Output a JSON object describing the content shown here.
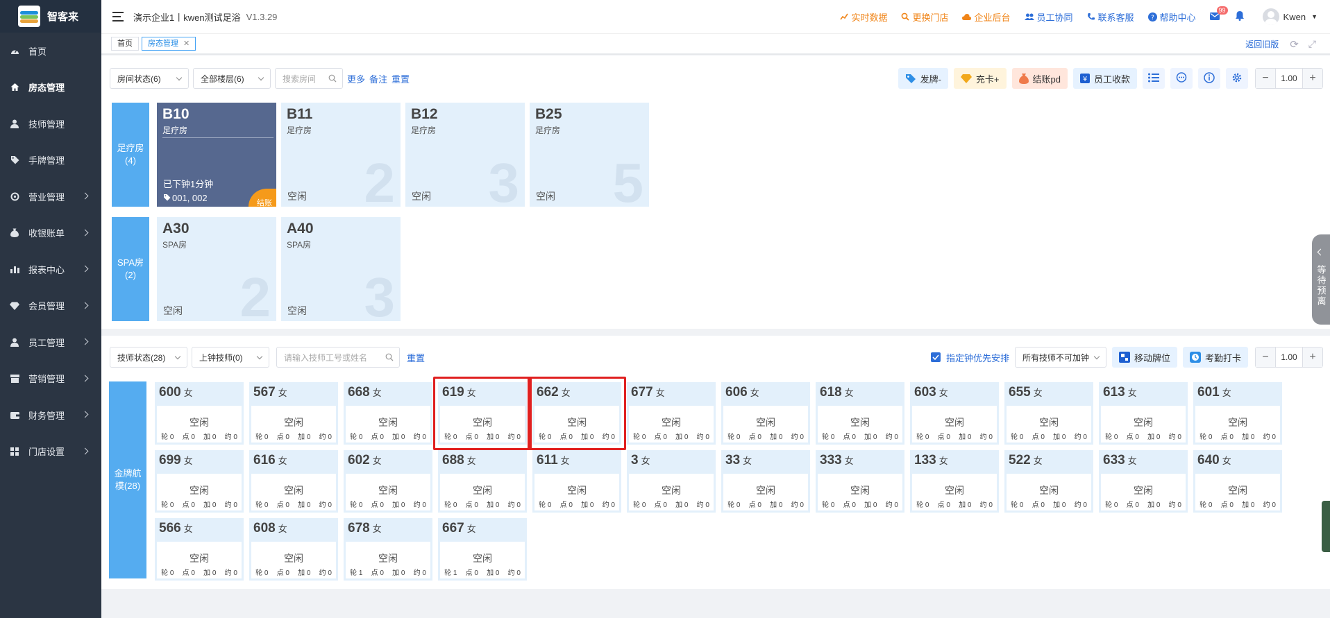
{
  "app": {
    "name": "智客来",
    "title": "演示企业1丨kwen测试足浴",
    "version": "V1.3.29"
  },
  "sidebar": {
    "items": [
      {
        "label": "首页",
        "icon": "dashboard-icon"
      },
      {
        "label": "房态管理",
        "icon": "home-icon",
        "active": true
      },
      {
        "label": "技师管理",
        "icon": "user-icon"
      },
      {
        "label": "手牌管理",
        "icon": "tag-icon"
      },
      {
        "label": "营业管理",
        "icon": "target-icon",
        "arrow": true
      },
      {
        "label": "收银账单",
        "icon": "money-bag-icon",
        "arrow": true
      },
      {
        "label": "报表中心",
        "icon": "bar-chart-icon",
        "arrow": true
      },
      {
        "label": "会员管理",
        "icon": "diamond-icon",
        "arrow": true
      },
      {
        "label": "员工管理",
        "icon": "user-icon",
        "arrow": true
      },
      {
        "label": "营销管理",
        "icon": "shop-icon",
        "arrow": true
      },
      {
        "label": "财务管理",
        "icon": "wallet-icon",
        "arrow": true
      },
      {
        "label": "门店设置",
        "icon": "grid-icon",
        "arrow": true
      }
    ]
  },
  "header": {
    "links": [
      {
        "label": "实时数据",
        "color": "#f08519"
      },
      {
        "label": "更换门店",
        "color": "#f08519"
      },
      {
        "label": "企业后台",
        "color": "#f08519"
      },
      {
        "label": "员工协同",
        "color": "#2d6ed8"
      },
      {
        "label": "联系客服",
        "color": "#2d6ed8"
      },
      {
        "label": "帮助中心",
        "color": "#2d6ed8"
      }
    ],
    "mail_badge": "99",
    "user": "Kwen"
  },
  "tabs": {
    "items": [
      {
        "label": "首页"
      },
      {
        "label": "房态管理",
        "active": true
      }
    ],
    "back_label": "返回旧版"
  },
  "rooms": {
    "filters": {
      "status": "房间状态(6)",
      "floor": "全部楼层(6)",
      "search_placeholder": "搜索房间",
      "more": "更多",
      "note": "备注",
      "reset": "重置"
    },
    "tools": {
      "fapai": "发牌-",
      "chongka": "充卡+",
      "jiezhang": "结账pd",
      "shoukuan": "员工收款",
      "zoom": "1.00"
    },
    "groups": [
      {
        "label": "足疗房\n(4)",
        "rooms": [
          {
            "no": "B10",
            "type": "足疗房",
            "busy": true,
            "line1": "已下钟1分钟",
            "line2": "001, 002",
            "corner": "结账"
          },
          {
            "no": "B11",
            "type": "足疗房",
            "big": "2",
            "status": "空闲"
          },
          {
            "no": "B12",
            "type": "足疗房",
            "big": "3",
            "status": "空闲"
          },
          {
            "no": "B25",
            "type": "足疗房",
            "big": "5",
            "status": "空闲"
          }
        ]
      },
      {
        "label": "SPA房\n(2)",
        "rooms": [
          {
            "no": "A30",
            "type": "SPA房",
            "big": "2",
            "status": "空闲"
          },
          {
            "no": "A40",
            "type": "SPA房",
            "big": "3",
            "status": "空闲"
          }
        ]
      }
    ]
  },
  "techs": {
    "filters": {
      "status": "技师状态(28)",
      "on_clock": "上钟技师(0)",
      "search_placeholder": "请输入技师工号或姓名",
      "reset": "重置",
      "priority_label": "指定钟优先安排",
      "add_clock": "所有技师不可加钟",
      "move": "移动牌位",
      "attendance": "考勤打卡",
      "zoom": "1.00"
    },
    "group_label": "金牌航\n模(28)",
    "count_labels": [
      "轮",
      "点",
      "加",
      "约"
    ],
    "items": [
      {
        "no": "600",
        "sex": "女",
        "status": "空闲",
        "c": [
          0,
          0,
          0,
          0
        ]
      },
      {
        "no": "567",
        "sex": "女",
        "status": "空闲",
        "c": [
          0,
          0,
          0,
          0
        ]
      },
      {
        "no": "668",
        "sex": "女",
        "status": "空闲",
        "c": [
          0,
          0,
          0,
          0
        ]
      },
      {
        "no": "619",
        "sex": "女",
        "status": "空闲",
        "c": [
          0,
          0,
          0,
          0
        ],
        "highlight": true
      },
      {
        "no": "662",
        "sex": "女",
        "status": "空闲",
        "c": [
          0,
          0,
          0,
          0
        ],
        "highlight": true
      },
      {
        "no": "677",
        "sex": "女",
        "status": "空闲",
        "c": [
          0,
          0,
          0,
          0
        ]
      },
      {
        "no": "606",
        "sex": "女",
        "status": "空闲",
        "c": [
          0,
          0,
          0,
          0
        ]
      },
      {
        "no": "618",
        "sex": "女",
        "status": "空闲",
        "c": [
          0,
          0,
          0,
          0
        ]
      },
      {
        "no": "603",
        "sex": "女",
        "status": "空闲",
        "c": [
          0,
          0,
          0,
          0
        ]
      },
      {
        "no": "655",
        "sex": "女",
        "status": "空闲",
        "c": [
          0,
          0,
          0,
          0
        ]
      },
      {
        "no": "613",
        "sex": "女",
        "status": "空闲",
        "c": [
          0,
          0,
          0,
          0
        ]
      },
      {
        "no": "601",
        "sex": "女",
        "status": "空闲",
        "c": [
          0,
          0,
          0,
          0
        ]
      },
      {
        "no": "699",
        "sex": "女",
        "status": "空闲",
        "c": [
          0,
          0,
          0,
          0
        ]
      },
      {
        "no": "616",
        "sex": "女",
        "status": "空闲",
        "c": [
          0,
          0,
          0,
          0
        ]
      },
      {
        "no": "602",
        "sex": "女",
        "status": "空闲",
        "c": [
          0,
          0,
          0,
          0
        ]
      },
      {
        "no": "688",
        "sex": "女",
        "status": "空闲",
        "c": [
          0,
          0,
          0,
          0
        ]
      },
      {
        "no": "611",
        "sex": "女",
        "status": "空闲",
        "c": [
          0,
          0,
          0,
          0
        ]
      },
      {
        "no": "3",
        "sex": "女",
        "status": "空闲",
        "c": [
          0,
          0,
          0,
          0
        ]
      },
      {
        "no": "33",
        "sex": "女",
        "status": "空闲",
        "c": [
          0,
          0,
          0,
          0
        ]
      },
      {
        "no": "333",
        "sex": "女",
        "status": "空闲",
        "c": [
          0,
          0,
          0,
          0
        ]
      },
      {
        "no": "133",
        "sex": "女",
        "status": "空闲",
        "c": [
          0,
          0,
          0,
          0
        ]
      },
      {
        "no": "522",
        "sex": "女",
        "status": "空闲",
        "c": [
          0,
          0,
          0,
          0
        ]
      },
      {
        "no": "633",
        "sex": "女",
        "status": "空闲",
        "c": [
          0,
          0,
          0,
          0
        ]
      },
      {
        "no": "640",
        "sex": "女",
        "status": "空闲",
        "c": [
          0,
          0,
          0,
          0
        ]
      },
      {
        "no": "566",
        "sex": "女",
        "status": "空闲",
        "c": [
          0,
          0,
          0,
          0
        ]
      },
      {
        "no": "608",
        "sex": "女",
        "status": "空闲",
        "c": [
          0,
          0,
          0,
          0
        ]
      },
      {
        "no": "678",
        "sex": "女",
        "status": "空闲",
        "c": [
          1,
          0,
          0,
          0
        ]
      },
      {
        "no": "667",
        "sex": "女",
        "status": "空闲",
        "c": [
          1,
          0,
          0,
          0
        ]
      }
    ]
  },
  "side_float": "等待预离"
}
